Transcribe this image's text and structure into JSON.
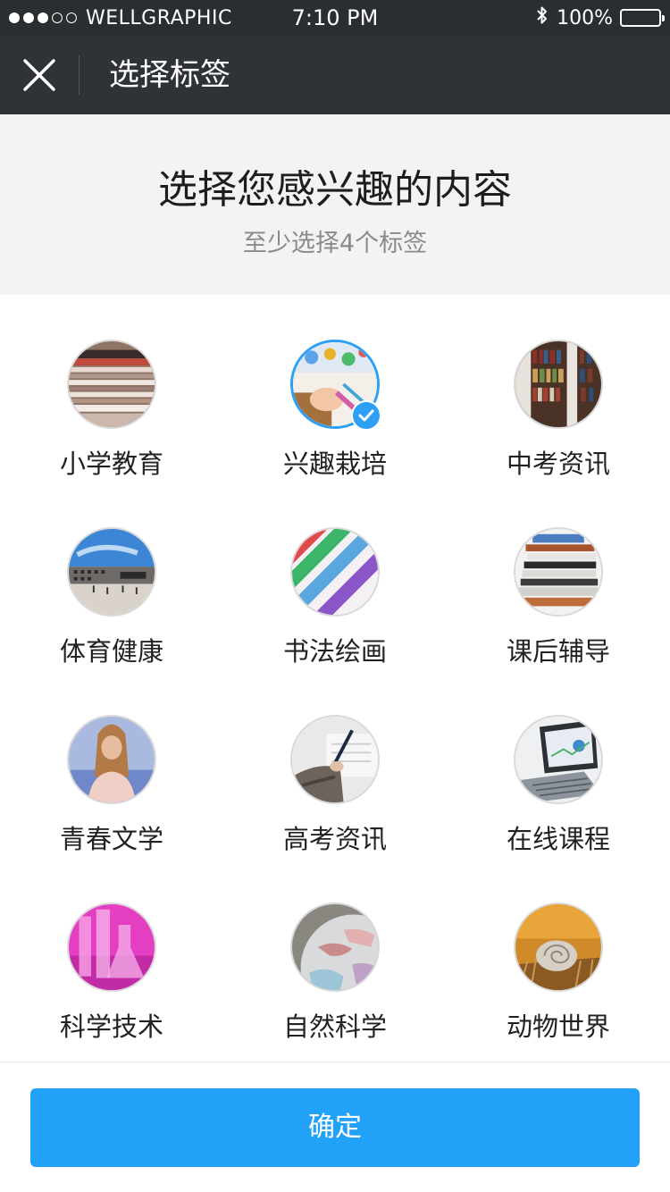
{
  "status_bar": {
    "carrier": "WELLGRAPHIC",
    "time": "7:10 PM",
    "battery": "100%",
    "signal_filled": 3,
    "signal_total": 5,
    "icons": [
      "bluetooth-icon",
      "battery-icon"
    ]
  },
  "nav": {
    "title": "选择标签",
    "close_icon": "close-icon"
  },
  "header": {
    "title": "选择您感兴趣的内容",
    "subtitle": "至少选择4个标签"
  },
  "tags": [
    {
      "label": "小学教育",
      "selected": false
    },
    {
      "label": "兴趣栽培",
      "selected": true
    },
    {
      "label": "中考资讯",
      "selected": false
    },
    {
      "label": "体育健康",
      "selected": false
    },
    {
      "label": "书法绘画",
      "selected": false
    },
    {
      "label": "课后辅导",
      "selected": false
    },
    {
      "label": "青春文学",
      "selected": false
    },
    {
      "label": "高考资讯",
      "selected": false
    },
    {
      "label": "在线课程",
      "selected": false
    },
    {
      "label": "科学技术",
      "selected": false
    },
    {
      "label": "自然科学",
      "selected": false
    },
    {
      "label": "动物世界",
      "selected": false
    }
  ],
  "footer": {
    "confirm_label": "确定"
  },
  "colors": {
    "accent": "#21a1f7",
    "nav_bg": "#2f3236",
    "status_bg": "#2b2e31",
    "header_bg": "#f3f3f3"
  }
}
